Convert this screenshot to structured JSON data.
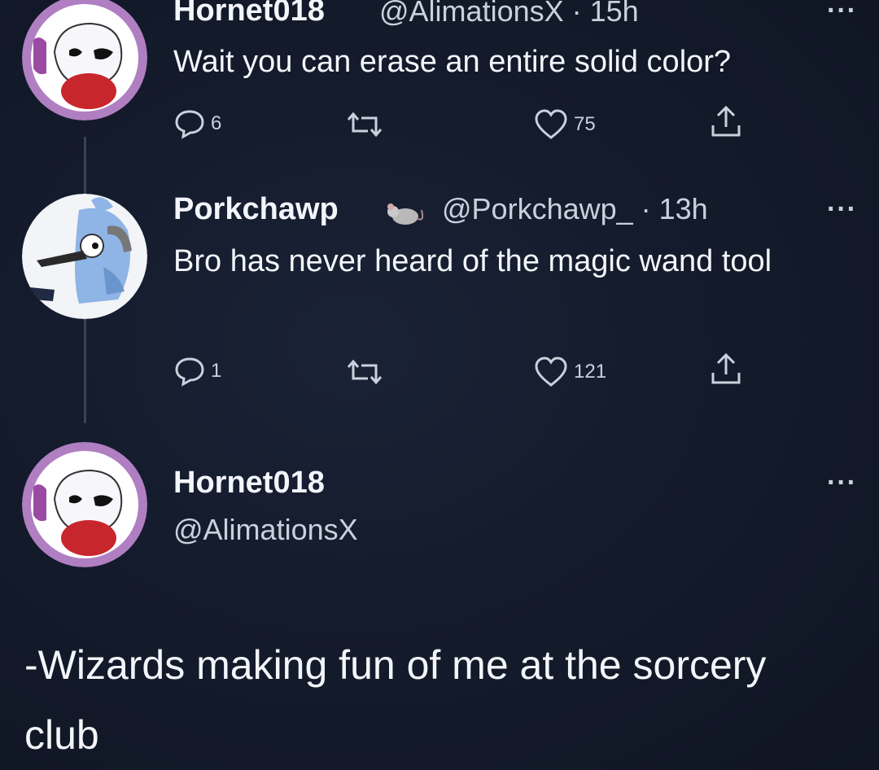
{
  "tweet1": {
    "name": "Hornet018",
    "meta": "@AlimationsX · 15h",
    "text": "Wait you can erase an entire solid color?",
    "more": "···",
    "replies": "6",
    "likes": "75"
  },
  "tweet2": {
    "name": "Porkchawp",
    "meta": "@Porkchawp_ · 13h",
    "text": "Bro has never heard of the magic wand tool",
    "more": "···",
    "replies": "1",
    "likes": "121"
  },
  "tweet3": {
    "name": "Hornet018",
    "handle": "@AlimationsX",
    "more": "···"
  },
  "caption": "-Wizards making fun of me at the sorcery club",
  "icons": {
    "reply": "reply-icon",
    "retweet": "retweet-icon",
    "like": "heart-icon",
    "share": "share-icon"
  },
  "colors": {
    "background": "#141b2c",
    "text": "#f2f5f9",
    "secondary": "#c9d1dc"
  }
}
